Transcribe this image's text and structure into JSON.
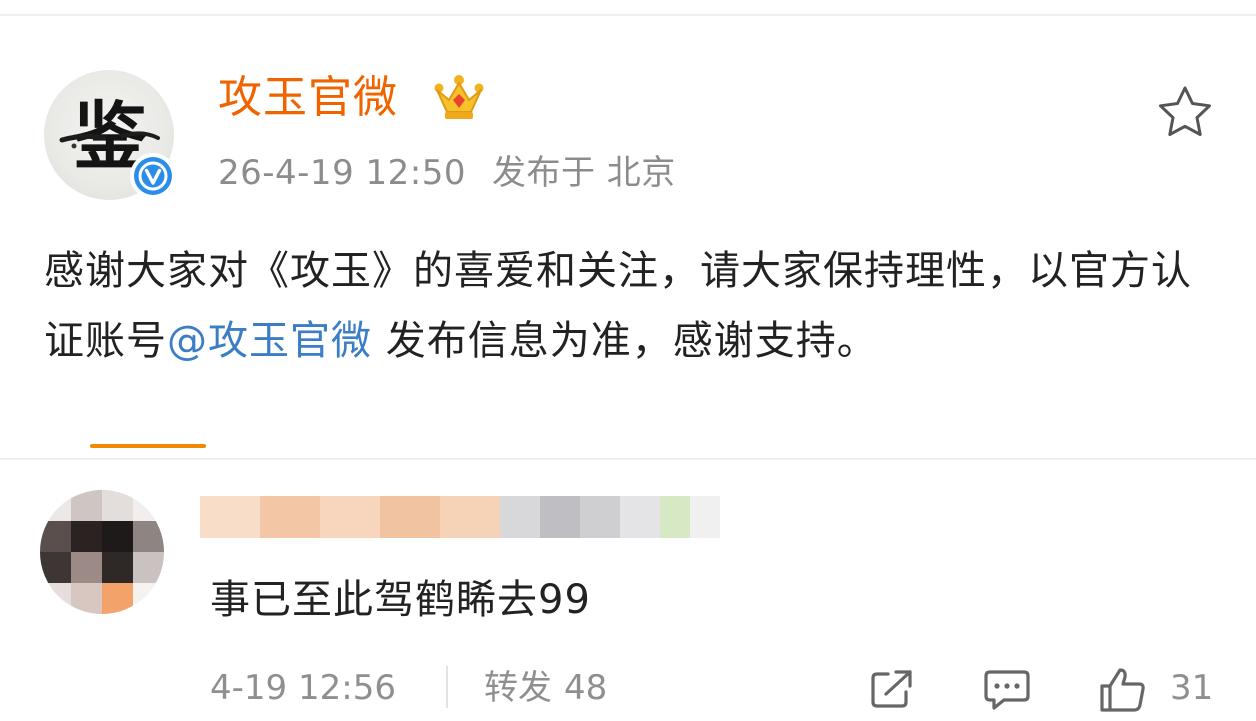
{
  "post": {
    "username": "攻玉官微",
    "timestamp": "26-4-19 12:50",
    "location": "发布于 北京",
    "text_before_mention": "感谢大家对《攻玉》的喜爱和关注，请大家保持理性，以官方认证账号",
    "mention": "@攻玉官微",
    "text_after_mention": " 发布信息为准，感谢支持。",
    "avatar_glyph": "鉴",
    "icons": {
      "crown": "crown-icon",
      "verified": "verified-badge-icon",
      "favorite": "star-icon"
    }
  },
  "comment": {
    "text": "事已至此驾鹤睎去99",
    "time": "4-19 12:56",
    "repost_label": "转发",
    "repost_count": "48",
    "like_count": "31",
    "icons": {
      "share": "share-icon",
      "comment": "comment-icon",
      "like": "thumbs-up-icon"
    }
  },
  "colors": {
    "username": "#f06400",
    "mention": "#3b7ec6",
    "meta_text": "#8c8c8c",
    "verified": "#2a8ee8",
    "tab_underline": "#f08a00"
  }
}
